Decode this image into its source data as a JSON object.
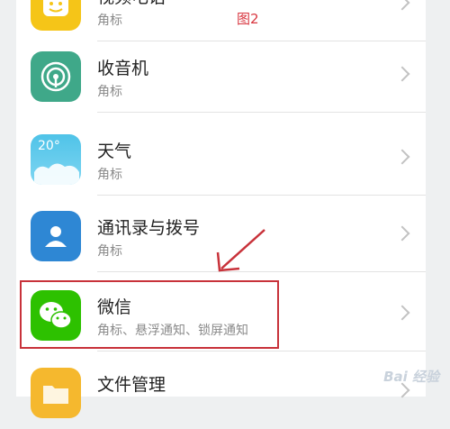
{
  "figure_label": "图2",
  "apps": [
    {
      "name": "视频电话",
      "subtitle": "角标",
      "icon": "video-call-icon",
      "color": "#f5c518"
    },
    {
      "name": "收音机",
      "subtitle": "角标",
      "icon": "radio-icon",
      "color": "#3fa889"
    },
    {
      "name": "天气",
      "subtitle": "角标",
      "icon": "weather-icon",
      "icon_text": "20°",
      "color": "#4fc3e8"
    },
    {
      "name": "通讯录与拨号",
      "subtitle": "角标",
      "icon": "contacts-icon",
      "color": "#2e87d4"
    },
    {
      "name": "微信",
      "subtitle": "角标、悬浮通知、锁屏通知",
      "icon": "wechat-icon",
      "color": "#2dc100"
    },
    {
      "name": "文件管理",
      "subtitle": "",
      "icon": "folder-icon",
      "color": "#f5b82e"
    }
  ],
  "watermark": "Bai 经验",
  "accent_red": "#c8323a"
}
